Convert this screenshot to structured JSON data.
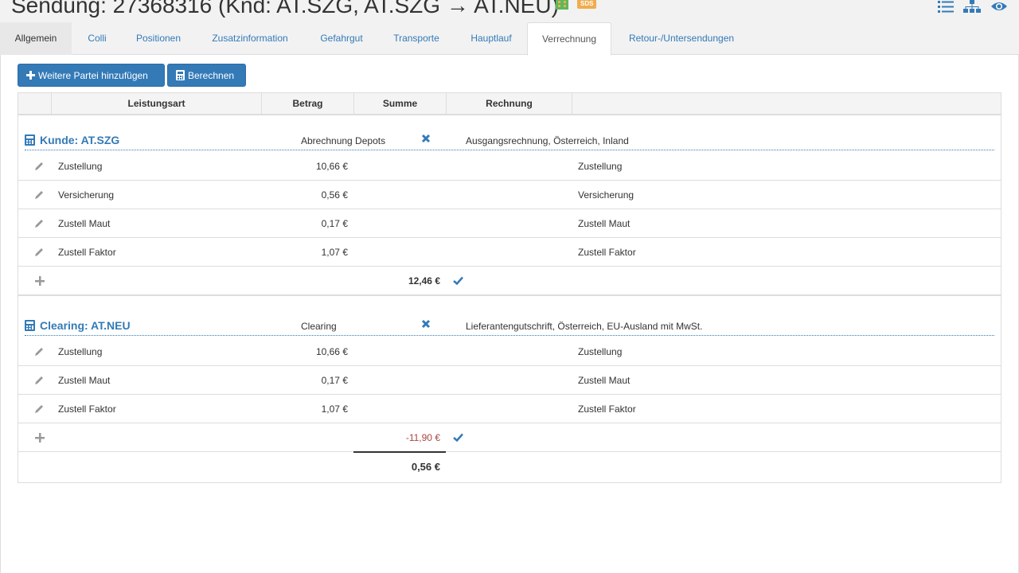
{
  "header": {
    "title": "Sendung: 27368316 (Knd: AT.SZG, AT.SZG → AT.NEU)",
    "badge": "SDS"
  },
  "icons": {
    "building": "building-icon",
    "list": "list-icon",
    "sitemap": "sitemap-icon",
    "eye": "eye-icon",
    "calculator": "calculator-icon",
    "pencil": "pencil-icon",
    "plus": "plus-icon",
    "remove": "remove-icon",
    "check": "check-icon"
  },
  "colors": {
    "primary": "#337ab7",
    "negative": "#a94442",
    "badge": "#f0ad4e",
    "building": "#5cb85c"
  },
  "tabs": [
    {
      "label": "Allgemein"
    },
    {
      "label": "Colli"
    },
    {
      "label": "Positionen"
    },
    {
      "label": "Zusatzinformation"
    },
    {
      "label": "Gefahrgut"
    },
    {
      "label": "Transporte"
    },
    {
      "label": "Hauptlauf"
    },
    {
      "label": "Verrechnung"
    },
    {
      "label": "Retour-/Untersendungen"
    }
  ],
  "toolbar": {
    "add_party_label": "Weitere Partei hinzufügen",
    "calculate_label": "Berechnen"
  },
  "table": {
    "headers": [
      "Leistungsart",
      "Betrag",
      "Summe",
      "Rechnung"
    ],
    "groups": [
      {
        "title": "Kunde: AT.SZG",
        "type": "Abrechnung Depots",
        "invoice": "Ausgangsrechnung, Österreich, Inland",
        "rows": [
          {
            "service": "Zustellung",
            "amount": "10,66 €",
            "invoice": "Zustellung"
          },
          {
            "service": "Versicherung",
            "amount": "0,56 €",
            "invoice": "Versicherung"
          },
          {
            "service": "Zustell Maut",
            "amount": "0,17 €",
            "invoice": "Zustell Maut"
          },
          {
            "service": "Zustell Faktor",
            "amount": "1,07 €",
            "invoice": "Zustell Faktor"
          }
        ],
        "sum": "12,46 €"
      },
      {
        "title": "Clearing: AT.NEU",
        "type": "Clearing",
        "invoice": "Lieferantengutschrift, Österreich, EU-Ausland mit MwSt.",
        "rows": [
          {
            "service": "Zustellung",
            "amount": "10,66 €",
            "invoice": "Zustellung"
          },
          {
            "service": "Zustell Maut",
            "amount": "0,17 €",
            "invoice": "Zustell Maut"
          },
          {
            "service": "Zustell Faktor",
            "amount": "1,07 €",
            "invoice": "Zustell Faktor"
          }
        ],
        "sum": "-11,90 €"
      }
    ],
    "total": "0,56 €"
  }
}
